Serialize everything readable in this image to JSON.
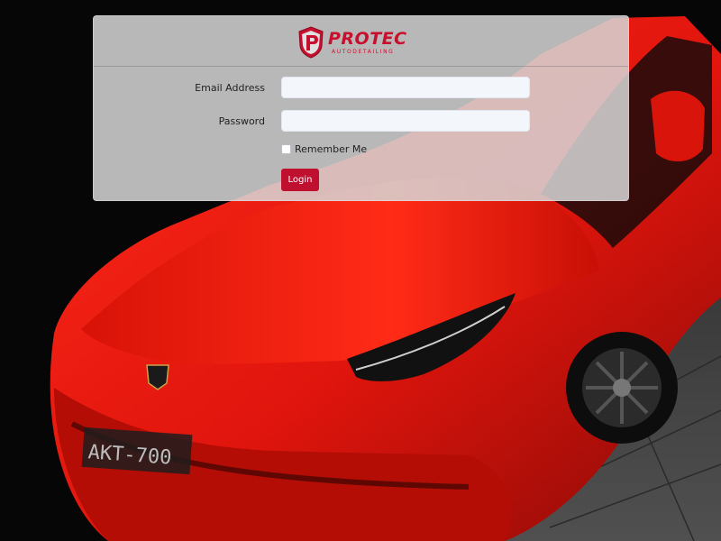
{
  "brand": {
    "name": "PROTEC",
    "tagline": "AUTODETAILING",
    "color": "#c8102e"
  },
  "form": {
    "email_label": "Email Address",
    "email_value": "",
    "password_label": "Password",
    "password_value": "",
    "remember_label": "Remember Me",
    "remember_checked": false,
    "login_label": "Login"
  },
  "background": {
    "plate_text": "AKT-700"
  }
}
